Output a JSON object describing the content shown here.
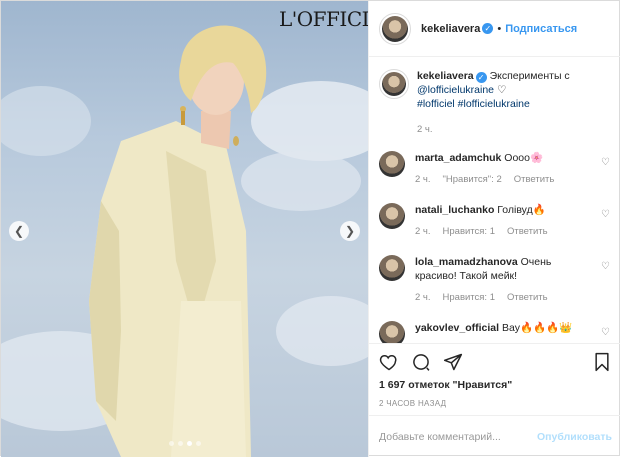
{
  "photo": {
    "brand": "L'OFFICIEL",
    "prev_icon": "chevron-left-icon",
    "next_icon": "chevron-right-icon",
    "dots_count": 4,
    "active_dot": 3
  },
  "header": {
    "username": "kekeliavera",
    "follow_label": "Подписаться",
    "separator": "•"
  },
  "caption": {
    "username": "kekeliavera",
    "text": "Эксперименты с",
    "mention": "@lofficielukraine",
    "heart": "♡",
    "hashtags": "#lofficiel #lofficielukraine",
    "time": "2 ч."
  },
  "comments": [
    {
      "username": "marta_adamchuk",
      "text": "Оооо🌸",
      "time": "2 ч.",
      "likes": "\"Нравится\": 2",
      "reply": "Ответить"
    },
    {
      "username": "natali_luchanko",
      "text": "Голівуд🔥",
      "time": "2 ч.",
      "likes": "Нравится: 1",
      "reply": "Ответить"
    },
    {
      "username": "lola_mamadzhanova",
      "text": "Очень красиво! Такой мейк!",
      "time": "2 ч.",
      "likes": "Нравится: 1",
      "reply": "Ответить"
    },
    {
      "username": "yakovlev_official",
      "text": "Вау🔥🔥🔥👑",
      "time": "",
      "likes": "",
      "reply": ""
    }
  ],
  "actions": {
    "like_icon": "heart-icon",
    "comment_icon": "comment-icon",
    "share_icon": "share-icon",
    "save_icon": "bookmark-icon"
  },
  "likes_text": "1 697 отметок \"Нравится\"",
  "posted_ago": "2 ЧАСОВ НАЗАД",
  "add_comment": {
    "placeholder": "Добавьте комментарий...",
    "publish_label": "Опубликовать"
  },
  "colors": {
    "accent": "#3897f0",
    "publish_disabled": "#b2dffc",
    "muted": "#8e8e8e"
  }
}
